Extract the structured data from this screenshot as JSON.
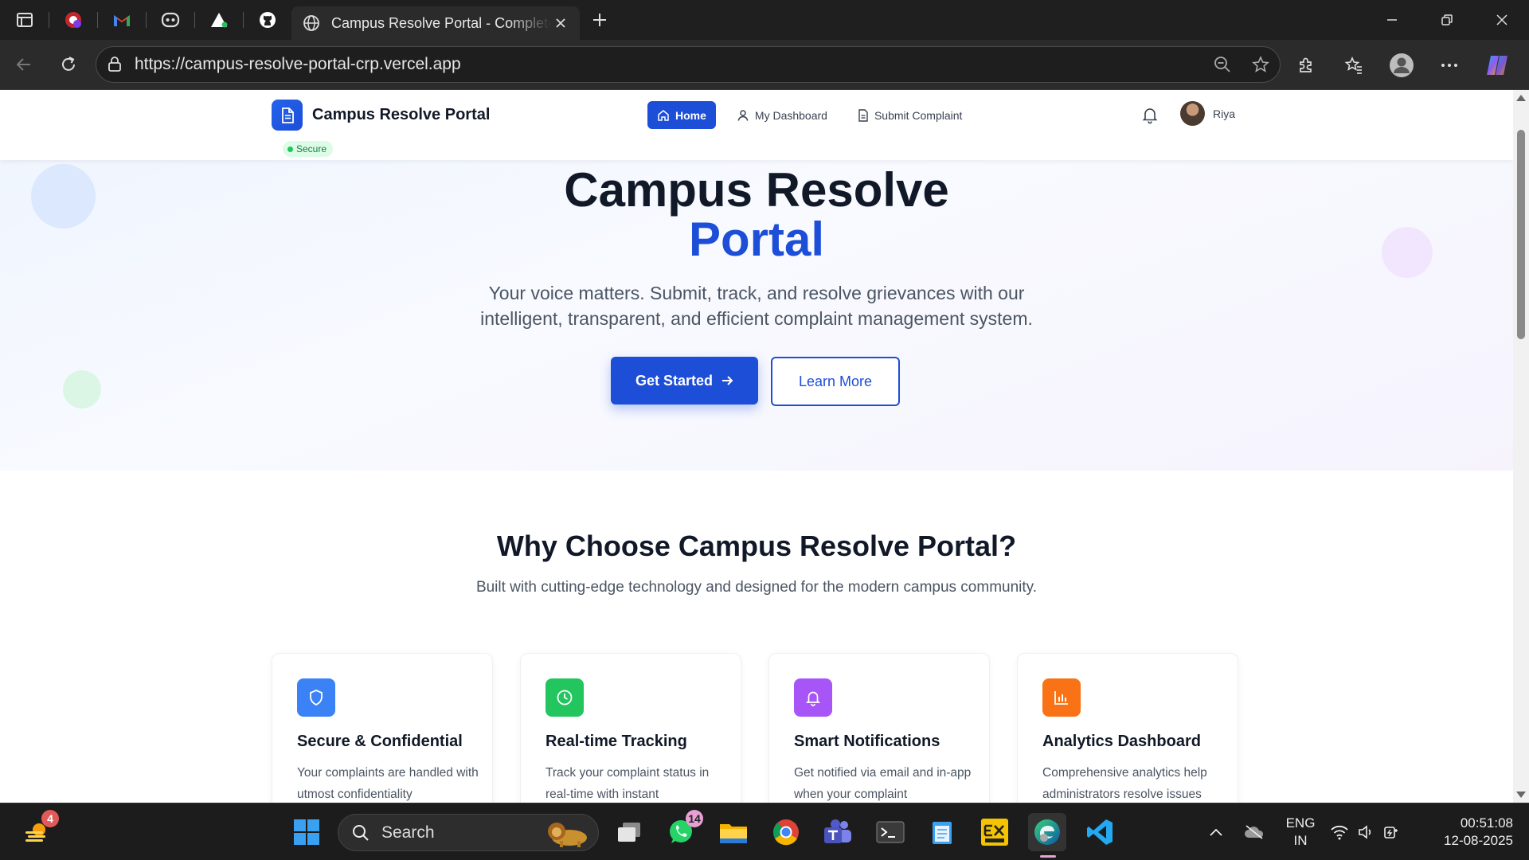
{
  "browser": {
    "tab_title": "Campus Resolve Portal - Complete Grievance Management System",
    "url": "https://campus-resolve-portal-crp.vercel.app",
    "pinned_tabs": [
      "copilot-icon",
      "gmail-icon",
      "discord-icon",
      "vercel-icon",
      "github-icon"
    ]
  },
  "header": {
    "brand": "Campus Resolve Portal",
    "secure_label": "Secure",
    "nav": [
      {
        "label": "Home",
        "icon": "home-icon",
        "active": true
      },
      {
        "label": "My Dashboard",
        "icon": "user-icon",
        "active": false
      },
      {
        "label": "Submit Complaint",
        "icon": "document-icon",
        "active": false
      }
    ],
    "user_name": "Riya"
  },
  "hero": {
    "title_line1": "Campus Resolve",
    "title_line2": "Portal",
    "subtitle": "Your voice matters. Submit, track, and resolve grievances with our intelligent, transparent, and efficient complaint management system.",
    "primary_button": "Get Started",
    "secondary_button": "Learn More"
  },
  "features": {
    "title": "Why Choose Campus Resolve Portal?",
    "subtitle": "Built with cutting-edge technology and designed for the modern campus community.",
    "cards": [
      {
        "title": "Secure & Confidential",
        "desc": "Your complaints are handled with utmost confidentiality",
        "icon": "shield-icon",
        "color": "#3b82f6"
      },
      {
        "title": "Real-time Tracking",
        "desc": "Track your complaint status in real-time with instant",
        "icon": "clock-icon",
        "color": "#22c55e"
      },
      {
        "title": "Smart Notifications",
        "desc": "Get notified via email and in-app when your complaint",
        "icon": "bell-icon",
        "color": "#a855f7"
      },
      {
        "title": "Analytics Dashboard",
        "desc": "Comprehensive analytics help administrators resolve issues",
        "icon": "bar-chart-icon",
        "color": "#f97316"
      }
    ]
  },
  "taskbar": {
    "search_label": "Search",
    "widgets_badge": "4",
    "whatsapp_badge": "14",
    "language": "ENG",
    "region": "IN",
    "time": "00:51:08",
    "date": "12-08-2025"
  }
}
